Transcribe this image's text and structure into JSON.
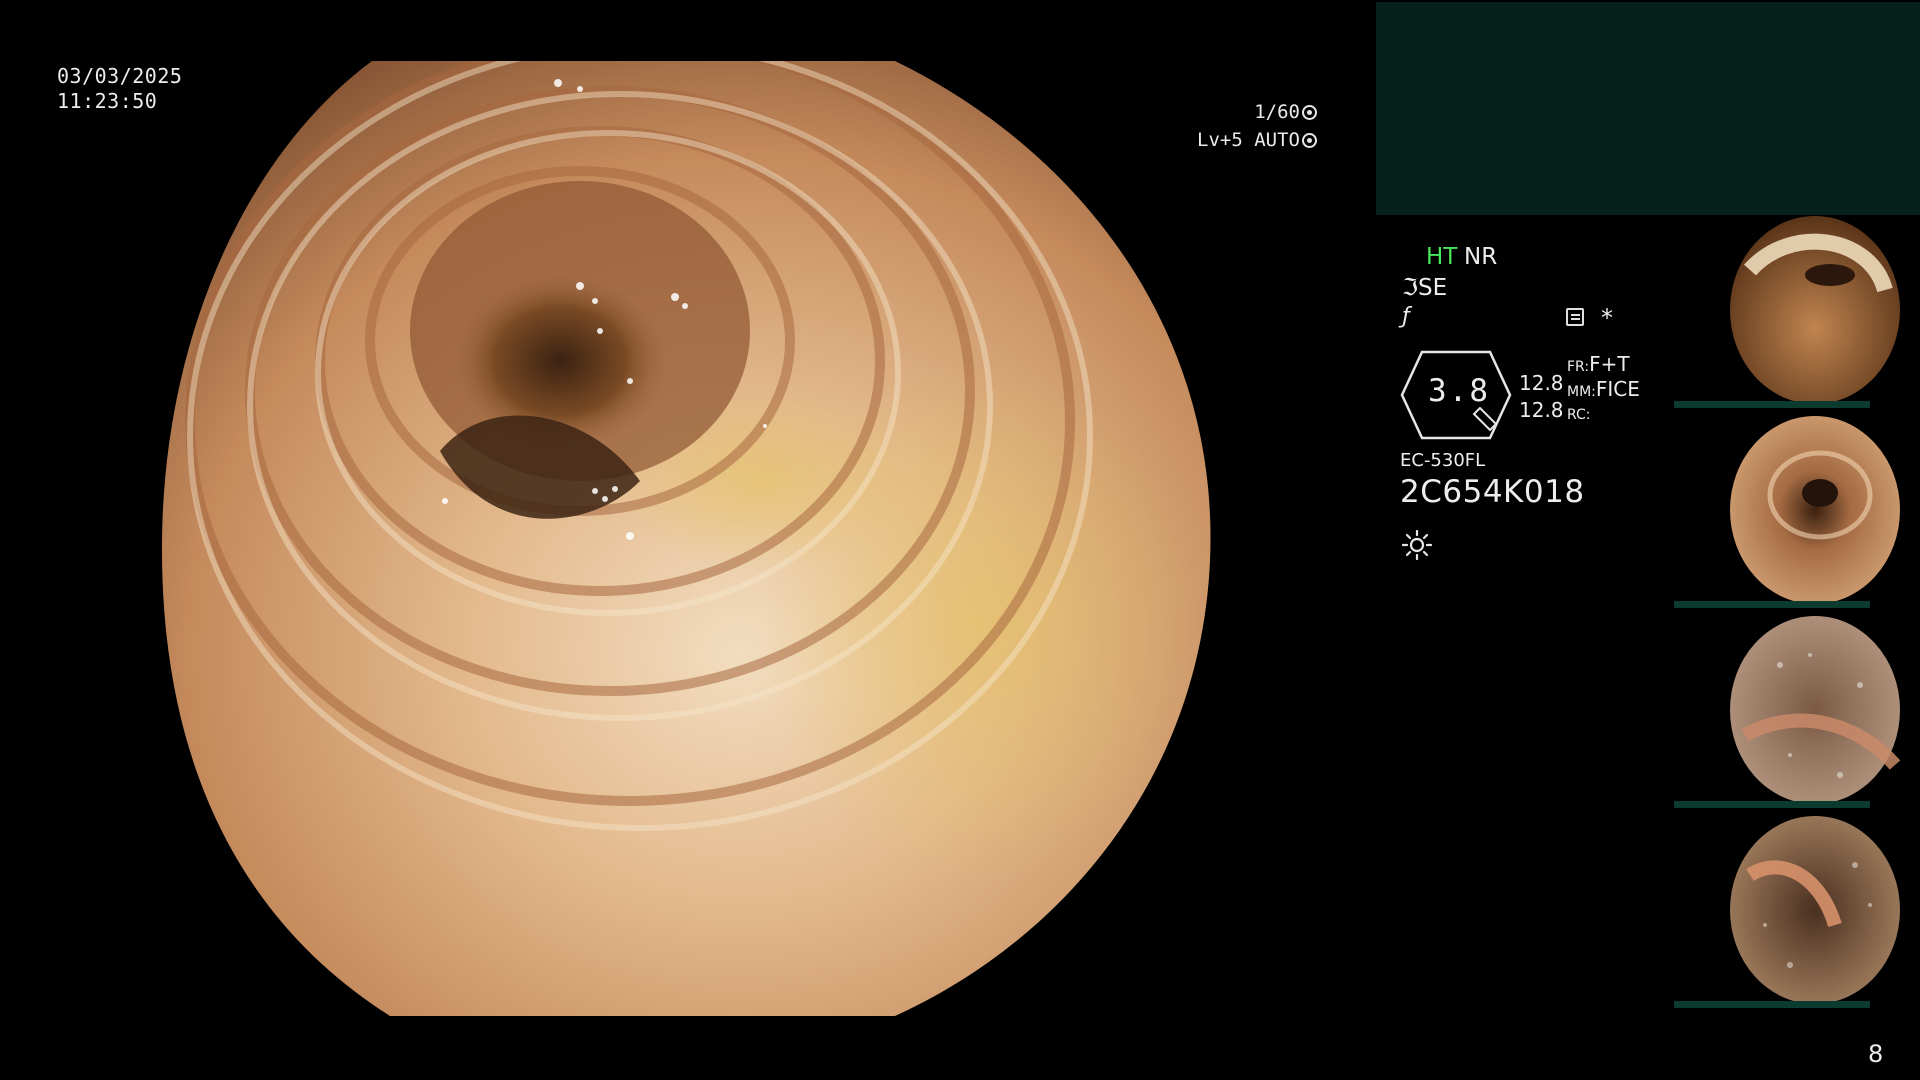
{
  "datetime": {
    "date": "03/03/2025",
    "time": "11:23:50"
  },
  "exposure": {
    "shutter": "1/60",
    "level": "Lv+5",
    "mode": "AUTO"
  },
  "settings": {
    "ht": "HT",
    "nr": "NR",
    "se": "SE",
    "zoom": "3.8",
    "fr_label": "FR:",
    "fr_value": "F+T",
    "mm_label": "MM:",
    "mm_value": "FICE",
    "rc_label": "RC:",
    "val1": "12.8",
    "val2": "12.8",
    "scope_model": "EC-530FL",
    "scope_serial": "2C654K018"
  },
  "thumbnail_bar_color": "#0b3a2f",
  "accent_green": "#48e65a",
  "panel_color": "#06211c",
  "page_number": "8"
}
